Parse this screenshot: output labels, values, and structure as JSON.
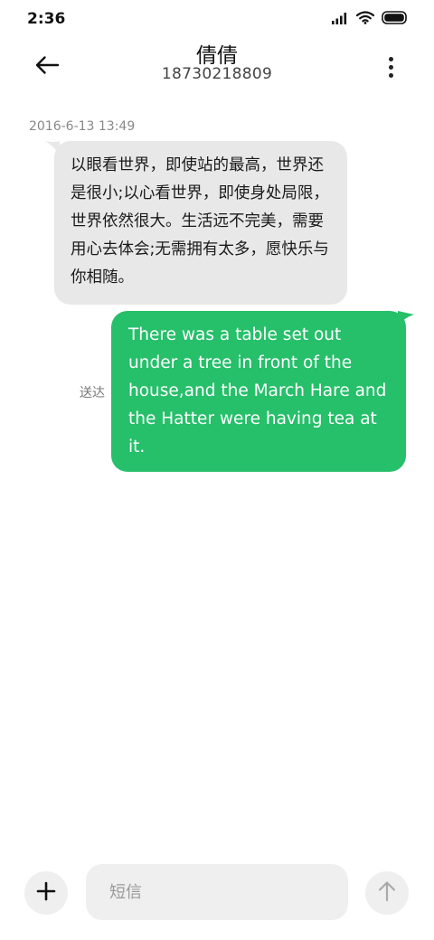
{
  "status_bar": {
    "time": "2:36",
    "icons": [
      "signal-icon",
      "wifi-icon",
      "battery-icon"
    ]
  },
  "header": {
    "back_icon": "arrow-left-icon",
    "contact_name": "倩倩",
    "contact_number": "18730218809",
    "more_icon": "more-vertical-icon"
  },
  "conversation": {
    "timestamp": "2016-6-13 13:49",
    "messages": [
      {
        "direction": "incoming",
        "text": "以眼看世界，即使站的最高，世界还是很小;以心看世界，即使身处局限，世界依然很大。生活远不完美，需要用心去体会;无需拥有太多，愿快乐与你相随。"
      },
      {
        "direction": "outgoing",
        "text": "There was a table set out under a tree in front of the house,and the March Hare and the Hatter were having tea at it.",
        "status": "送达"
      }
    ]
  },
  "composer": {
    "add_icon": "plus-icon",
    "placeholder": "短信",
    "value": "",
    "send_icon": "arrow-up-icon"
  },
  "colors": {
    "incoming_bubble": "#e8e8e8",
    "outgoing_bubble": "#26bf6a",
    "background": "#ffffff"
  }
}
